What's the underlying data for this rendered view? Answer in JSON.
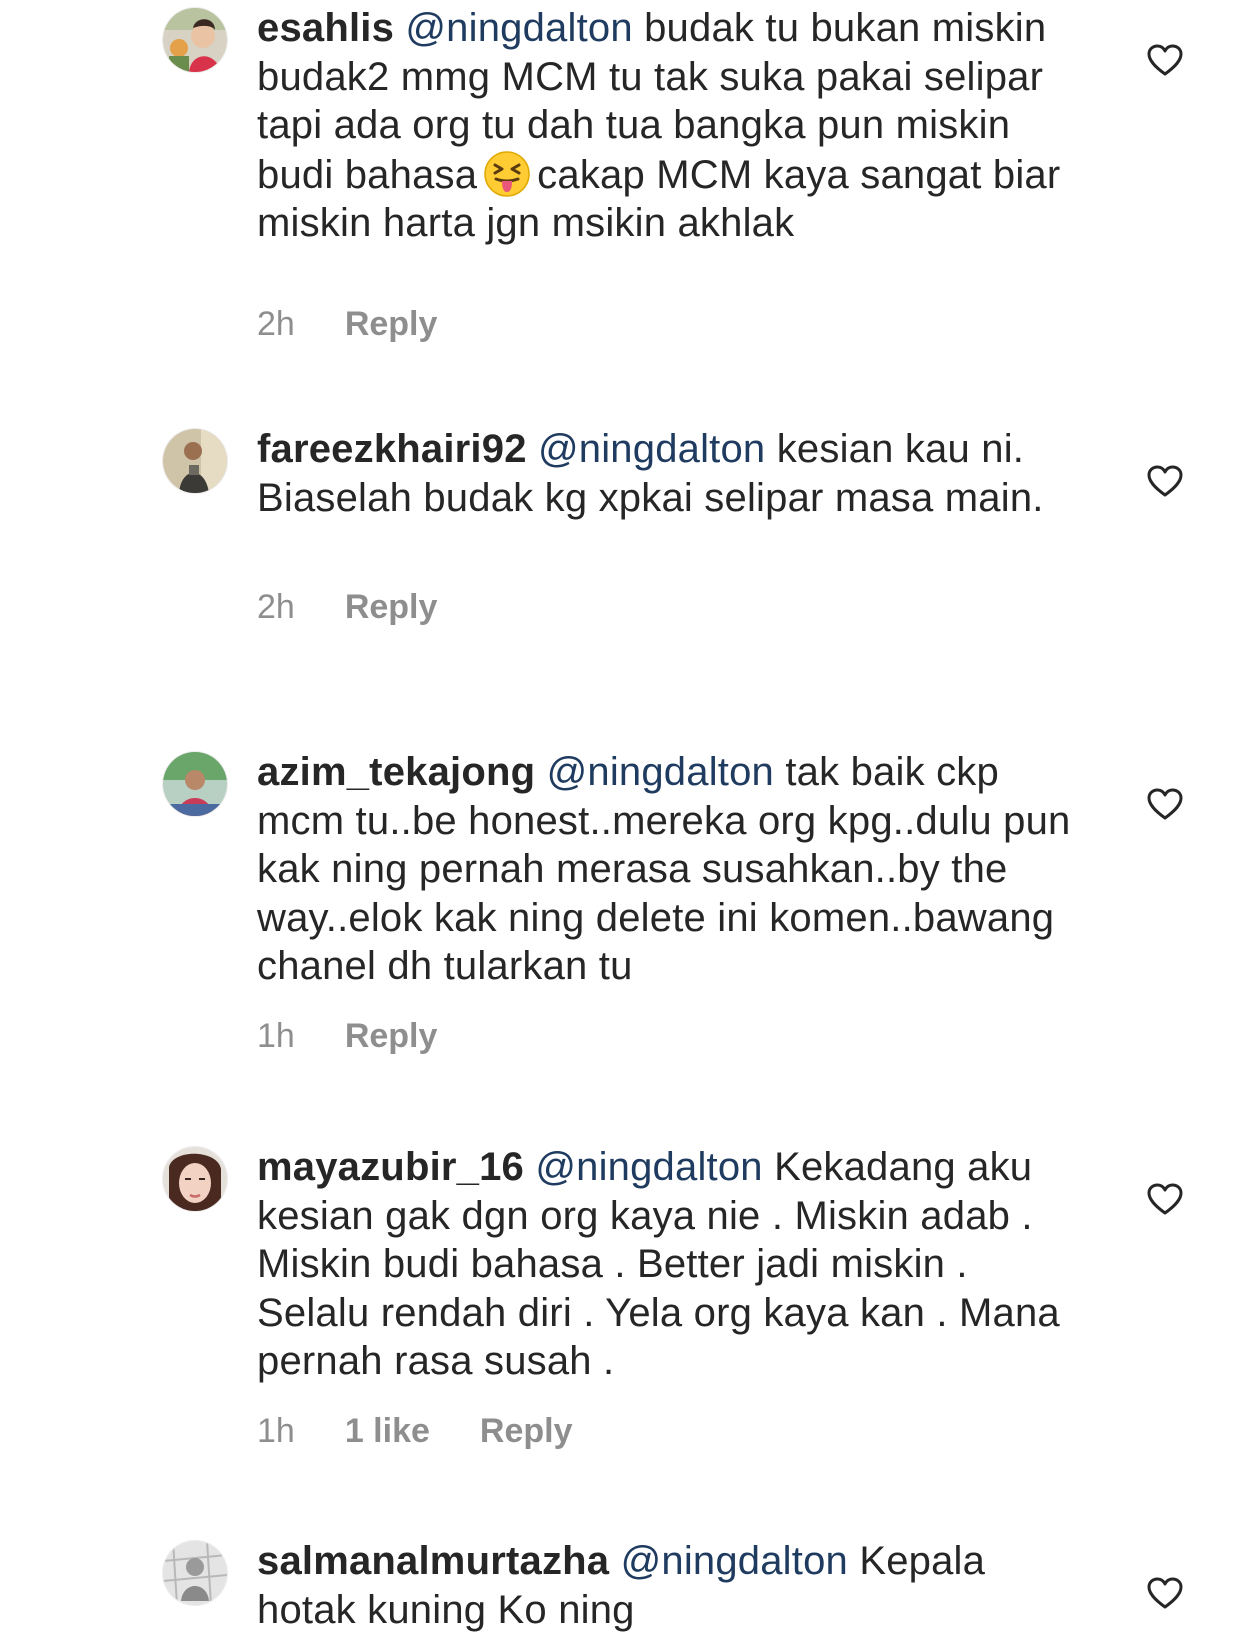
{
  "comments": [
    {
      "username": "esahlis",
      "mention": "@ningdalton",
      "text_before_emoji": " budak tu bukan miskin budak2 mmg MCM tu tak suka pakai selipar tapi ada org tu dah tua bangka pun miskin budi bahasa",
      "emoji": "squinting-tongue-emoji",
      "text_after_emoji": "cakap MCM kaya sangat biar miskin harta jgn msikin akhlak",
      "time": "2h",
      "likes": "",
      "reply_label": "Reply"
    },
    {
      "username": "fareezkhairi92",
      "mention": "@ningdalton",
      "text": "kesian kau ni. Biaselah budak kg xpkai selipar masa main.",
      "time": "2h",
      "likes": "",
      "reply_label": "Reply"
    },
    {
      "username": "azim_tekajong",
      "mention": "@ningdalton",
      "text": "tak baik ckp mcm tu..be honest..mereka org kpg..dulu pun kak ning pernah merasa susahkan..by the way..elok kak ning delete ini komen..bawang chanel dh tularkan tu",
      "time": "1h",
      "likes": "",
      "reply_label": "Reply"
    },
    {
      "username": "mayazubir_16",
      "mention": "@ningdalton",
      "text": "Kekadang aku kesian gak dgn org kaya nie . Miskin adab . Miskin budi bahasa . Better jadi miskin . Selalu rendah diri . Yela org kaya kan . Mana pernah rasa susah .",
      "time": "1h",
      "likes": "1 like",
      "reply_label": "Reply"
    },
    {
      "username": "salmanalmurtazha",
      "mention": "@ningdalton",
      "text": "Kepala hotak kuning Ko ning",
      "time": "",
      "likes": "",
      "reply_label": ""
    }
  ],
  "colors": {
    "text": "#262626",
    "mention": "#1f3c60",
    "meta": "#8e8e8e",
    "heart_outline": "#262626"
  },
  "icons": {
    "like": "heart-outline-icon"
  }
}
